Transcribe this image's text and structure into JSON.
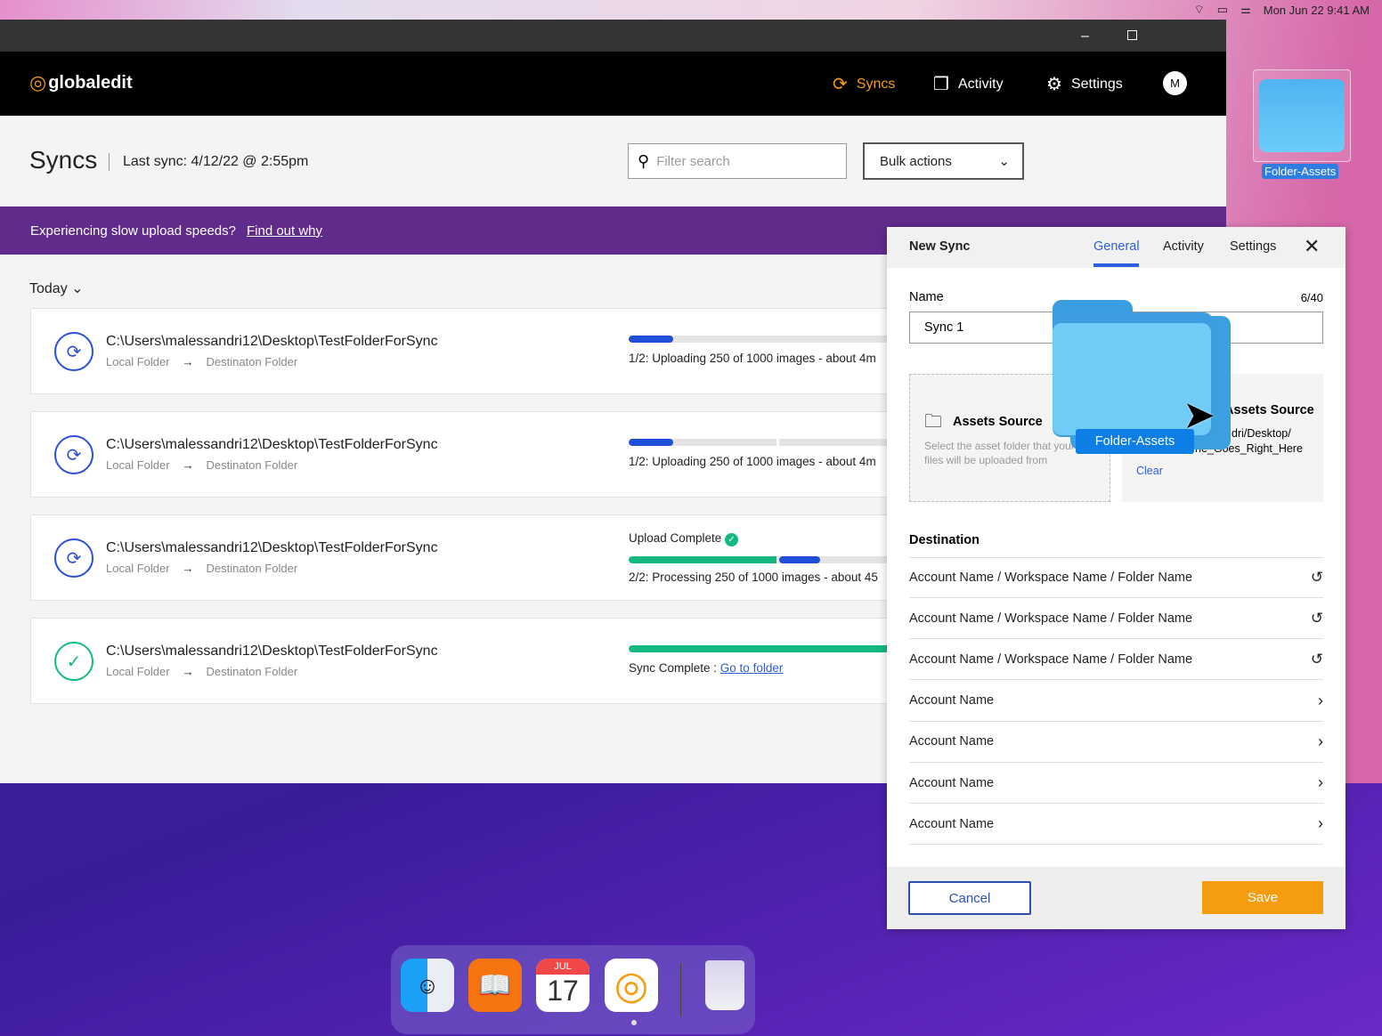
{
  "menubar": {
    "datetime": "Mon Jun 22  9:41 AM"
  },
  "nav": {
    "logo": "globaledit",
    "items": [
      {
        "label": "Syncs",
        "icon": "sync-icon",
        "active": true
      },
      {
        "label": "Activity",
        "icon": "files-icon"
      },
      {
        "label": "Settings",
        "icon": "gear-icon"
      }
    ],
    "avatar": "M"
  },
  "header": {
    "title": "Syncs",
    "last_sync": "Last sync: 4/12/22 @ 2:55pm",
    "search_placeholder": "Filter search",
    "bulk_actions": "Bulk actions"
  },
  "banner": {
    "text": "Experiencing slow upload speeds?",
    "link": "Find out why"
  },
  "filter": {
    "label": "Today"
  },
  "syncs": [
    {
      "path": "C:\\Users\\malessandri12\\Desktop\\TestFolderForSync",
      "local": "Local Folder",
      "dest": "Destinaton Folder",
      "status": "1/2: Uploading 250 of 1000 images - about 4m",
      "progress": 0.25,
      "state": "syncing"
    },
    {
      "path": "C:\\Users\\malessandri12\\Desktop\\TestFolderForSync",
      "local": "Local Folder",
      "dest": "Destinaton Folder",
      "status": "1/2: Uploading 250 of 1000 images - about 4m",
      "progress": 0.25,
      "state": "syncing"
    },
    {
      "path": "C:\\Users\\malessandri12\\Desktop\\TestFolderForSync",
      "local": "Local Folder",
      "dest": "Destinaton Folder",
      "upload_label": "Upload Complete",
      "status": "2/2: Processing 250 of 1000 images - about 45",
      "progress": 0.25,
      "state": "processing"
    },
    {
      "path": "C:\\Users\\malessandri12\\Desktop\\TestFolderForSync",
      "local": "Local Folder",
      "dest": "Destinaton Folder",
      "status": "Sync Complete : ",
      "link": "Go to folder",
      "progress": 1,
      "state": "complete"
    }
  ],
  "panel": {
    "title": "New Sync",
    "tabs": [
      "General",
      "Activity",
      "Settings"
    ],
    "active_tab": "General",
    "name_label": "Name",
    "name_count": "6/40",
    "name_value": "Sync 1",
    "source_empty": {
      "title": "Assets Source",
      "hint": "Select the asset folder that your files will be uploaded from"
    },
    "source_set": {
      "title": "Assets Source",
      "path1": "dri/Desktop/",
      "path2": "ne_Goes_Right_Here",
      "clear": "Clear"
    },
    "destination_label": "Destination",
    "destinations": [
      {
        "label": "Account Name / Workspace Name / Folder Name",
        "icon": "history-icon"
      },
      {
        "label": "Account Name / Workspace Name / Folder Name",
        "icon": "history-icon"
      },
      {
        "label": "Account Name / Workspace Name / Folder Name",
        "icon": "history-icon"
      },
      {
        "label": "Account Name",
        "icon": "chevron-right-icon"
      },
      {
        "label": "Account Name",
        "icon": "chevron-right-icon"
      },
      {
        "label": "Account Name",
        "icon": "chevron-right-icon"
      },
      {
        "label": "Account Name",
        "icon": "chevron-right-icon"
      }
    ],
    "cancel": "Cancel",
    "save": "Save"
  },
  "drag": {
    "label": "Folder-Assets"
  },
  "desktop": {
    "folder_label": "Folder-Assets"
  },
  "dock": {
    "calendar_month": "JUL",
    "calendar_day": "17"
  },
  "colors": {
    "accent": "#f59d0e",
    "blue": "#1f4fd8",
    "green": "#13b981",
    "purple": "#612b8c"
  }
}
